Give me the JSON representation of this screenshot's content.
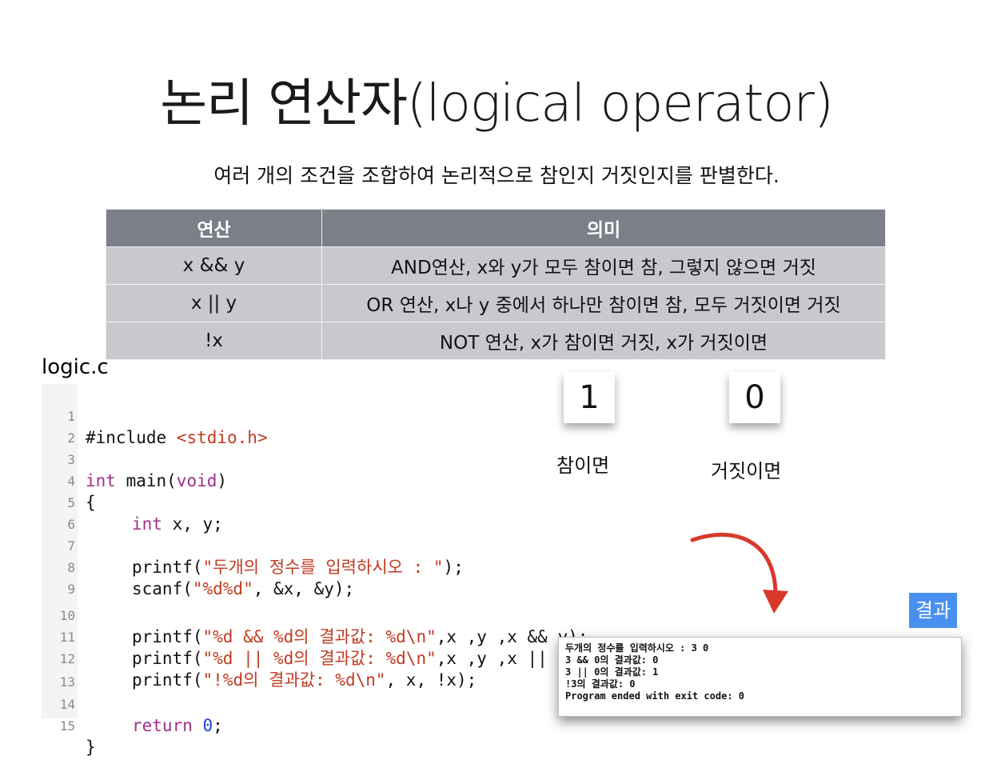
{
  "title": "논리 연산자(logical operator)",
  "subtitle": "여러 개의 조건을 조합하여 논리적으로 참인지 거짓인지를 판별한다.",
  "table": {
    "headers": [
      "연산",
      "의미"
    ],
    "rows": [
      [
        "x && y",
        "AND연산, x와 y가 모두 참이면 참, 그렇지 않으면 거짓"
      ],
      [
        "x || y",
        "OR 연산, x나 y 중에서 하나만 참이면 참, 모두 거짓이면 거짓"
      ],
      [
        "!x",
        "NOT 연산, x가 참이면 거짓, x가 거짓이면"
      ]
    ]
  },
  "filename": "logic.c",
  "code": {
    "line_numbers": [
      "1",
      "2",
      "3",
      "4",
      "5",
      "6",
      "7",
      "8",
      "9",
      "10",
      "11",
      "12",
      "13",
      "14",
      "15"
    ],
    "l1_a": "#include ",
    "l1_b": "<stdio.h>",
    "l3_a": "int",
    "l3_b": " main(",
    "l3_c": "void",
    "l3_d": ")",
    "l4": "{",
    "l5_a": "int",
    "l5_b": " x, y;",
    "l7_a": "printf(",
    "l7_b": "\"두개의 정수를 입력하시오 : \"",
    "l7_c": ");",
    "l8_a": "scanf(",
    "l8_b": "\"%d%d\"",
    "l8_c": ", &x, &y);",
    "l10_a": "printf(",
    "l10_b": "\"%d && %d의 결과값: %d\\n\"",
    "l10_c": ",x ,y ,x && y);",
    "l11_a": "printf(",
    "l11_b": "\"%d || %d의 결과값: %d\\n\"",
    "l11_c": ",x ,y ,x || y);",
    "l12_a": "printf(",
    "l12_b": "\"!%d의 결과값: %d\\n\"",
    "l12_c": ", x, !x);",
    "l14_a": "return ",
    "l14_b": "0",
    "l14_c": ";",
    "l15": "}"
  },
  "cards": {
    "true_value": "1",
    "true_label": "참이면",
    "false_value": "0",
    "false_label": "거짓이면"
  },
  "result_badge": "결과",
  "console": [
    "두개의 정수를 입력하시오 : 3 0",
    "3 && 0의 결과값: 0",
    "3 || 0의 결과값: 1",
    "!3의 결과값: 0",
    "Program ended with exit code: 0"
  ],
  "colors": {
    "header_bg": "#7b7f88",
    "row_bg": "#c8c9ce",
    "keyword": "#a0308a",
    "string": "#c23b22",
    "number": "#1f3fd1",
    "badge": "#4a90f0",
    "arrow": "#d8382a"
  }
}
